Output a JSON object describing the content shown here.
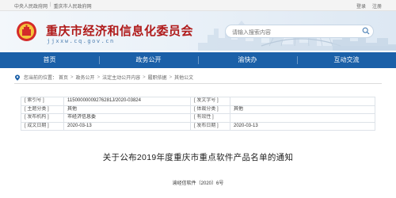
{
  "topbar": {
    "links_left": [
      "中央人民政府网",
      "重庆市人民政府网"
    ],
    "login": "登录",
    "register": "注册"
  },
  "header": {
    "title": "重庆市经济和信息化委员会",
    "domain": "jjxxw.cq.gov.cn",
    "search_placeholder": "请输入搜索内容"
  },
  "nav": {
    "items": [
      "首页",
      "政务公开",
      "渝快办",
      "互动交流"
    ]
  },
  "breadcrumb": {
    "prefix": "您当前的位置：",
    "items": [
      "首页",
      "政务公开",
      "法定主动公开内容",
      "履职依据",
      "其他公文"
    ]
  },
  "info": {
    "index_label": "[ 索引号 ]",
    "index_value": "11500000009276281J/2020-03824",
    "doc_no_label": "[ 发文字号 ]",
    "doc_no_value": "",
    "topic_label": "[ 主题分类 ]",
    "topic_value": "其他",
    "genre_label": "[ 体裁分类 ]",
    "genre_value": "其他",
    "issuer_label": "[ 发布机构 ]",
    "issuer_value": "市经济信息委",
    "validity_label": "[ 有效性 ]",
    "validity_value": "",
    "created_label": "[ 成文日期 ]",
    "created_value": "2020-03-13",
    "published_label": "[ 发布日期 ]",
    "published_value": "2020-03-13"
  },
  "document": {
    "title": "关于公布2019年度重庆市重点软件产品名单的通知",
    "number": "渝经信软件〔2020〕6号"
  },
  "colors": {
    "nav_blue": "#1b60a8",
    "title_red": "#b01b1b"
  }
}
